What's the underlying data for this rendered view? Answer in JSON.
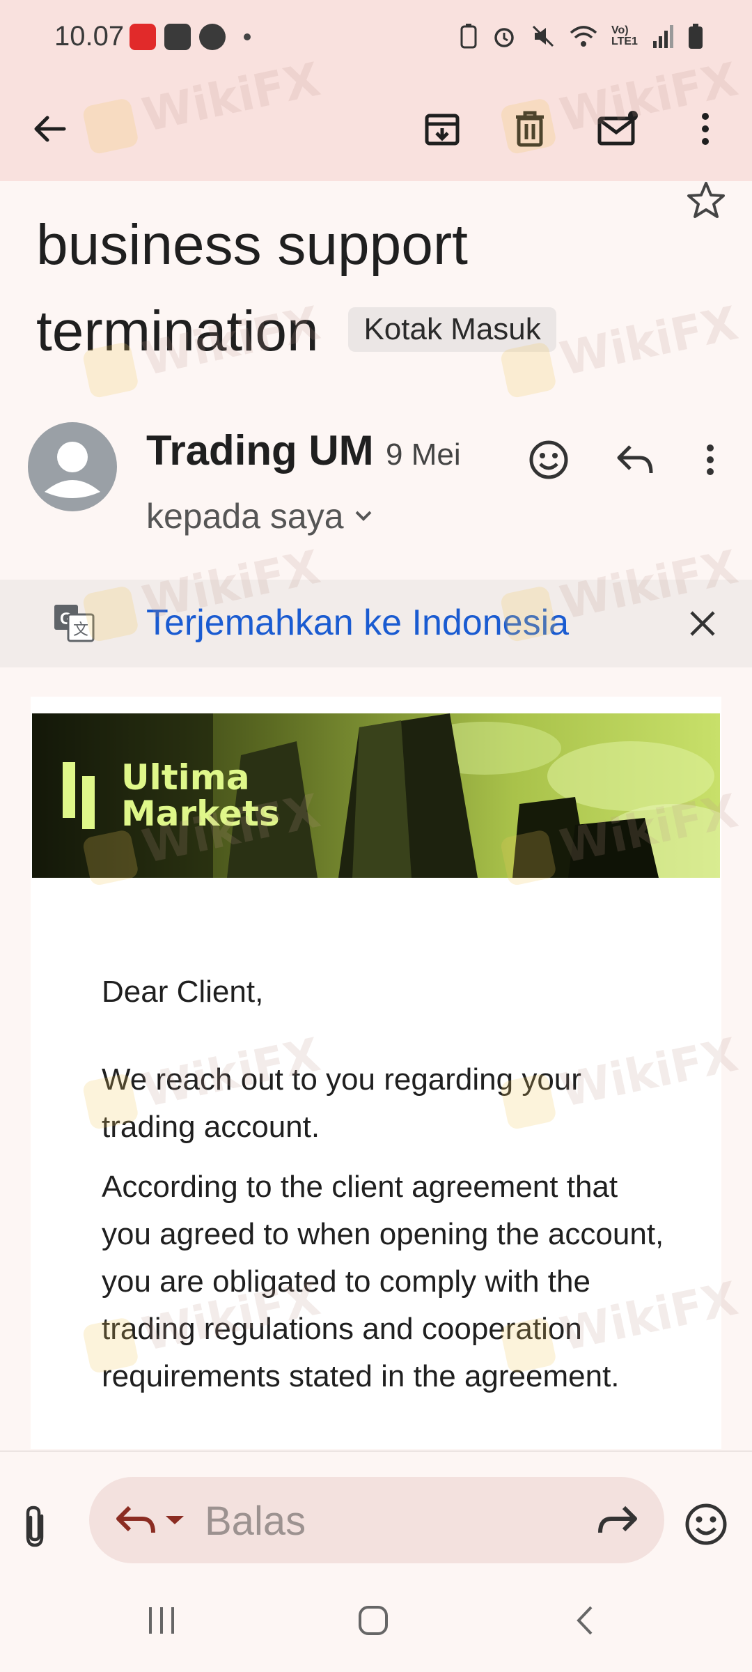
{
  "status_bar": {
    "time": "10.07",
    "network_label": "Vo) LTE1"
  },
  "toolbar": {
    "back": "back-icon",
    "archive": "archive-icon",
    "delete": "delete-icon",
    "mark_unread": "mark-unread-icon",
    "more": "more-vert-icon"
  },
  "email": {
    "subject": "business support termination",
    "label": "Kotak Masuk",
    "sender_name": "Trading UM",
    "date": "9 Mei",
    "recipient": "kepada saya"
  },
  "translate": {
    "link": "Terjemahkan ke Indonesia"
  },
  "body": {
    "banner_logo_line1": "Ultima",
    "banner_logo_line2": "Markets",
    "greeting": "Dear Client,",
    "p1": "We reach out to you regarding your trading account.",
    "p2": "According to the client agreement that you agreed to when opening the account, you are obligated to comply with the trading regulations and cooperation requirements stated in the agreement."
  },
  "reply_bar": {
    "placeholder": "Balas"
  },
  "watermark": "WikiFX",
  "colors": {
    "header_bg": "#f9e1de",
    "link_blue": "#1a5bd1",
    "brand_lime": "#dff78a",
    "reply_pill": "#f3e1de"
  }
}
